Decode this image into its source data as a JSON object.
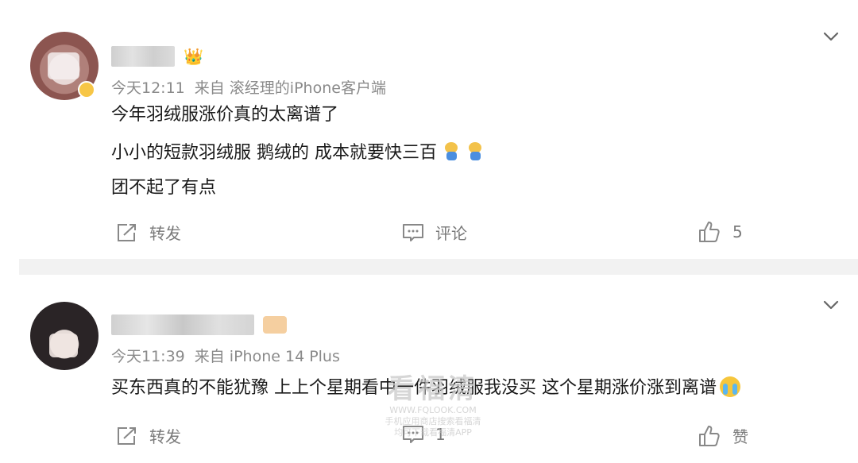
{
  "posts": [
    {
      "username": "",
      "badge": "👑",
      "time": "今天12:11",
      "source": "来自 滚经理的iPhone客户端",
      "lines": [
        "今年羽绒服涨价真的太离谱了",
        "小小的短款羽绒服 鹅绒的 成本就要快三百",
        "团不起了有点"
      ],
      "actions": {
        "repost": "转发",
        "comment": "评论",
        "like": "5"
      }
    },
    {
      "username": "",
      "time": "今天11:39",
      "source": "来自 iPhone 14 Plus",
      "lines": [
        "买东西真的不能犹豫 上上个星期看中一件羽绒服我没买 这个星期涨价涨到离谱"
      ],
      "actions": {
        "repost": "转发",
        "comment": "1",
        "like": "赞"
      }
    }
  ],
  "watermark": {
    "title": "看福清",
    "url": "WWW.FQLOOK.COM",
    "line1": "手机应用商店搜索看福清",
    "line2": "均可下载看福清APP"
  },
  "icons": {
    "menu": "chevron-down-icon",
    "repost": "share-icon",
    "comment": "comment-icon",
    "like": "thumbs-up-icon"
  },
  "colors": {
    "divider": "#f2f2f2",
    "meta": "#8a8a8a",
    "action": "#7a7a7a",
    "vip": "#f7c646"
  }
}
